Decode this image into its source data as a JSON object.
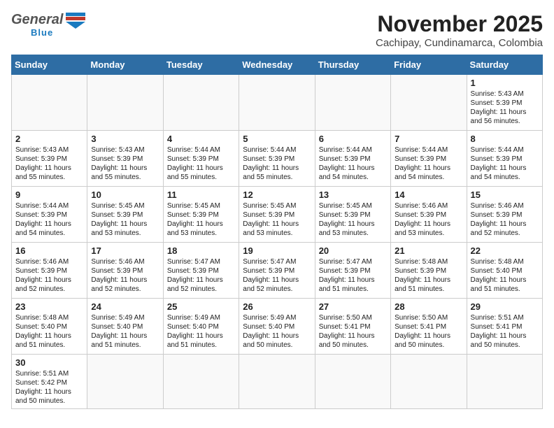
{
  "header": {
    "logo_general": "General",
    "logo_blue": "Blue",
    "title": "November 2025",
    "subtitle": "Cachipay, Cundinamarca, Colombia"
  },
  "days_of_week": [
    "Sunday",
    "Monday",
    "Tuesday",
    "Wednesday",
    "Thursday",
    "Friday",
    "Saturday"
  ],
  "weeks": [
    [
      {
        "day": "",
        "info": ""
      },
      {
        "day": "",
        "info": ""
      },
      {
        "day": "",
        "info": ""
      },
      {
        "day": "",
        "info": ""
      },
      {
        "day": "",
        "info": ""
      },
      {
        "day": "",
        "info": ""
      },
      {
        "day": "1",
        "info": "Sunrise: 5:43 AM\nSunset: 5:39 PM\nDaylight: 11 hours\nand 56 minutes."
      }
    ],
    [
      {
        "day": "2",
        "info": "Sunrise: 5:43 AM\nSunset: 5:39 PM\nDaylight: 11 hours\nand 55 minutes."
      },
      {
        "day": "3",
        "info": "Sunrise: 5:43 AM\nSunset: 5:39 PM\nDaylight: 11 hours\nand 55 minutes."
      },
      {
        "day": "4",
        "info": "Sunrise: 5:44 AM\nSunset: 5:39 PM\nDaylight: 11 hours\nand 55 minutes."
      },
      {
        "day": "5",
        "info": "Sunrise: 5:44 AM\nSunset: 5:39 PM\nDaylight: 11 hours\nand 55 minutes."
      },
      {
        "day": "6",
        "info": "Sunrise: 5:44 AM\nSunset: 5:39 PM\nDaylight: 11 hours\nand 54 minutes."
      },
      {
        "day": "7",
        "info": "Sunrise: 5:44 AM\nSunset: 5:39 PM\nDaylight: 11 hours\nand 54 minutes."
      },
      {
        "day": "8",
        "info": "Sunrise: 5:44 AM\nSunset: 5:39 PM\nDaylight: 11 hours\nand 54 minutes."
      }
    ],
    [
      {
        "day": "9",
        "info": "Sunrise: 5:44 AM\nSunset: 5:39 PM\nDaylight: 11 hours\nand 54 minutes."
      },
      {
        "day": "10",
        "info": "Sunrise: 5:45 AM\nSunset: 5:39 PM\nDaylight: 11 hours\nand 53 minutes."
      },
      {
        "day": "11",
        "info": "Sunrise: 5:45 AM\nSunset: 5:39 PM\nDaylight: 11 hours\nand 53 minutes."
      },
      {
        "day": "12",
        "info": "Sunrise: 5:45 AM\nSunset: 5:39 PM\nDaylight: 11 hours\nand 53 minutes."
      },
      {
        "day": "13",
        "info": "Sunrise: 5:45 AM\nSunset: 5:39 PM\nDaylight: 11 hours\nand 53 minutes."
      },
      {
        "day": "14",
        "info": "Sunrise: 5:46 AM\nSunset: 5:39 PM\nDaylight: 11 hours\nand 53 minutes."
      },
      {
        "day": "15",
        "info": "Sunrise: 5:46 AM\nSunset: 5:39 PM\nDaylight: 11 hours\nand 52 minutes."
      }
    ],
    [
      {
        "day": "16",
        "info": "Sunrise: 5:46 AM\nSunset: 5:39 PM\nDaylight: 11 hours\nand 52 minutes."
      },
      {
        "day": "17",
        "info": "Sunrise: 5:46 AM\nSunset: 5:39 PM\nDaylight: 11 hours\nand 52 minutes."
      },
      {
        "day": "18",
        "info": "Sunrise: 5:47 AM\nSunset: 5:39 PM\nDaylight: 11 hours\nand 52 minutes."
      },
      {
        "day": "19",
        "info": "Sunrise: 5:47 AM\nSunset: 5:39 PM\nDaylight: 11 hours\nand 52 minutes."
      },
      {
        "day": "20",
        "info": "Sunrise: 5:47 AM\nSunset: 5:39 PM\nDaylight: 11 hours\nand 51 minutes."
      },
      {
        "day": "21",
        "info": "Sunrise: 5:48 AM\nSunset: 5:39 PM\nDaylight: 11 hours\nand 51 minutes."
      },
      {
        "day": "22",
        "info": "Sunrise: 5:48 AM\nSunset: 5:40 PM\nDaylight: 11 hours\nand 51 minutes."
      }
    ],
    [
      {
        "day": "23",
        "info": "Sunrise: 5:48 AM\nSunset: 5:40 PM\nDaylight: 11 hours\nand 51 minutes."
      },
      {
        "day": "24",
        "info": "Sunrise: 5:49 AM\nSunset: 5:40 PM\nDaylight: 11 hours\nand 51 minutes."
      },
      {
        "day": "25",
        "info": "Sunrise: 5:49 AM\nSunset: 5:40 PM\nDaylight: 11 hours\nand 51 minutes."
      },
      {
        "day": "26",
        "info": "Sunrise: 5:49 AM\nSunset: 5:40 PM\nDaylight: 11 hours\nand 50 minutes."
      },
      {
        "day": "27",
        "info": "Sunrise: 5:50 AM\nSunset: 5:41 PM\nDaylight: 11 hours\nand 50 minutes."
      },
      {
        "day": "28",
        "info": "Sunrise: 5:50 AM\nSunset: 5:41 PM\nDaylight: 11 hours\nand 50 minutes."
      },
      {
        "day": "29",
        "info": "Sunrise: 5:51 AM\nSunset: 5:41 PM\nDaylight: 11 hours\nand 50 minutes."
      }
    ],
    [
      {
        "day": "30",
        "info": "Sunrise: 5:51 AM\nSunset: 5:42 PM\nDaylight: 11 hours\nand 50 minutes."
      },
      {
        "day": "",
        "info": ""
      },
      {
        "day": "",
        "info": ""
      },
      {
        "day": "",
        "info": ""
      },
      {
        "day": "",
        "info": ""
      },
      {
        "day": "",
        "info": ""
      },
      {
        "day": "",
        "info": ""
      }
    ]
  ]
}
